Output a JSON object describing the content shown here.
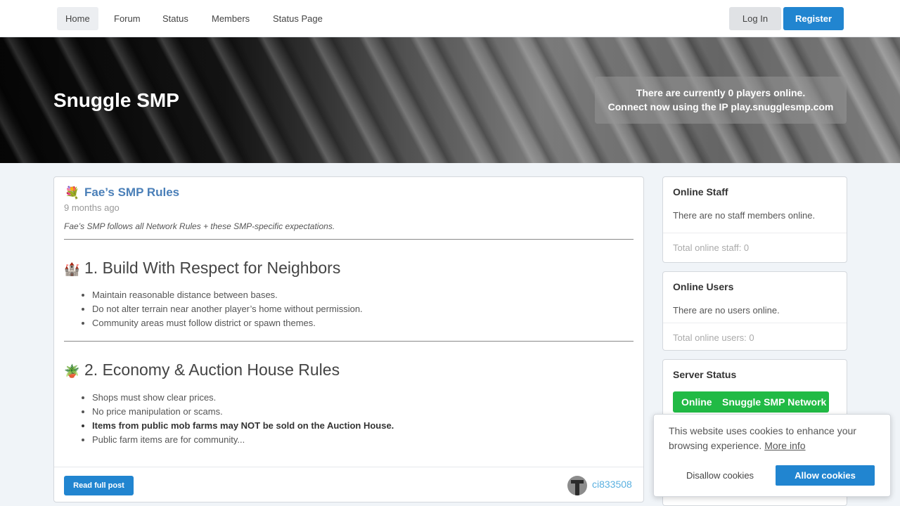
{
  "nav": {
    "items": [
      {
        "label": "Home",
        "active": true
      },
      {
        "label": "Forum",
        "active": false
      },
      {
        "label": "Status",
        "active": false
      },
      {
        "label": "Members",
        "active": false
      },
      {
        "label": "Status Page",
        "active": false
      }
    ],
    "login_label": "Log In",
    "register_label": "Register"
  },
  "hero": {
    "title": "Snuggle SMP",
    "players_text": "There are currently 0 players online.",
    "connect_text": "Connect now using the IP play.snugglesmp.com"
  },
  "post": {
    "icon": "bouquet-icon",
    "title": "Fae’s SMP Rules",
    "time": "9 months ago",
    "intro": "Fae’s SMP follows all Network Rules + these SMP-specific expectations.",
    "sections": [
      {
        "icon": "castle-icon",
        "title": "1. Build With Respect for Neighbors",
        "rules": [
          "Maintain reasonable distance between bases.",
          "Do not alter terrain near another player’s home without permission.",
          "Community areas must follow district or spawn themes."
        ]
      },
      {
        "icon": "potted-plant-icon",
        "title": "2. Economy & Auction House Rules",
        "rules": [
          "Shops must show clear prices.",
          "No price manipulation or scams.",
          "Items from public mob farms may NOT be sold on the Auction House.",
          "Public farm items are for community..."
        ]
      }
    ],
    "read_more_label": "Read full post",
    "author": "ci833508"
  },
  "sidebar": {
    "online_staff": {
      "title": "Online Staff",
      "text": "There are no staff members online.",
      "footer": "Total online staff: 0"
    },
    "online_users": {
      "title": "Online Users",
      "text": "There are no users online.",
      "footer": "Total online users: 0"
    },
    "server_status": {
      "title": "Server Status",
      "status": "Online",
      "network": "Snuggle SMP Network"
    }
  },
  "cookie": {
    "text": "This website uses cookies to enhance your browsing experience.",
    "more_info": "More info",
    "disallow_label": "Disallow cookies",
    "allow_label": "Allow cookies"
  },
  "colors": {
    "primary": "#2185d0",
    "online_green": "#21ba45",
    "post_title": "#4a7fb8",
    "author_link": "#5ab0e0"
  }
}
